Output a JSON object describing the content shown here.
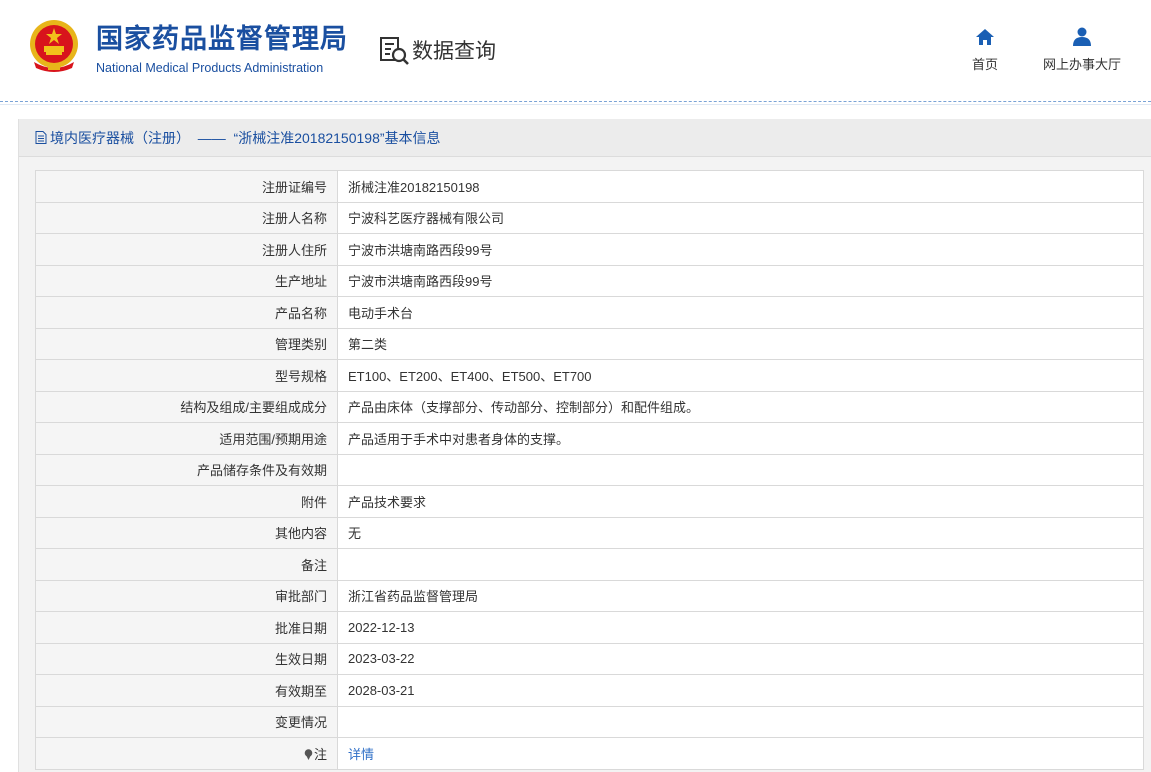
{
  "header": {
    "brand_cn": "国家药品监督管理局",
    "brand_en": "National Medical Products Administration",
    "query_label": "数据查询",
    "nav": [
      {
        "label": "首页",
        "icon": "home-icon"
      },
      {
        "label": "网上办事大厅",
        "icon": "user-icon"
      }
    ]
  },
  "panel": {
    "title": "境内医疗器械（注册）  ——  “浙械注准20182150198”基本信息"
  },
  "rows": [
    {
      "label": "注册证编号",
      "value": "浙械注准20182150198"
    },
    {
      "label": "注册人名称",
      "value": "宁波科艺医疗器械有限公司"
    },
    {
      "label": "注册人住所",
      "value": "宁波市洪塘南路西段99号"
    },
    {
      "label": "生产地址",
      "value": "宁波市洪塘南路西段99号"
    },
    {
      "label": "产品名称",
      "value": "电动手术台"
    },
    {
      "label": "管理类别",
      "value": "第二类"
    },
    {
      "label": "型号规格",
      "value": "ET100、ET200、ET400、ET500、ET700"
    },
    {
      "label": "结构及组成/主要组成成分",
      "value": "产品由床体（支撑部分、传动部分、控制部分）和配件组成。"
    },
    {
      "label": "适用范围/预期用途",
      "value": "产品适用于手术中对患者身体的支撑。"
    },
    {
      "label": "产品储存条件及有效期",
      "value": ""
    },
    {
      "label": "附件",
      "value": "产品技术要求"
    },
    {
      "label": "其他内容",
      "value": "无"
    },
    {
      "label": "备注",
      "value": ""
    },
    {
      "label": "审批部门",
      "value": "浙江省药品监督管理局"
    },
    {
      "label": "批准日期",
      "value": "2022-12-13"
    },
    {
      "label": "生效日期",
      "value": "2023-03-22"
    },
    {
      "label": "有效期至",
      "value": "2028-03-21"
    },
    {
      "label": "变更情况",
      "value": ""
    }
  ],
  "note_row": {
    "label": "注",
    "value": "详情",
    "icon": "pin-icon"
  },
  "colors": {
    "brand": "#1a4fa0",
    "link": "#2f6fc7",
    "emblem_red": "#d8141c",
    "emblem_gold": "#f2c21b"
  }
}
